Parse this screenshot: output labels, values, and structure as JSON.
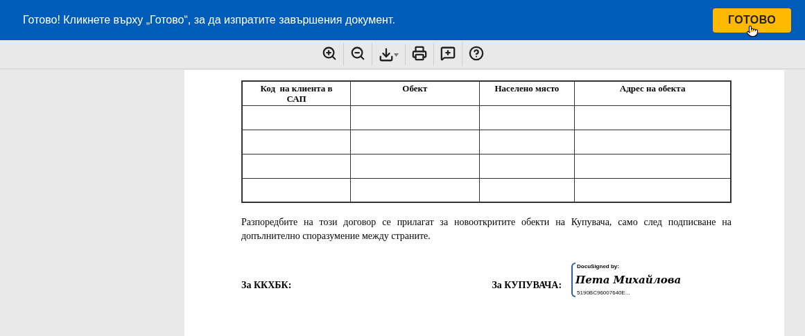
{
  "banner": {
    "message": "Готово! Кликнете върху „Готово“, за да изпратите завършения документ.",
    "button": "ГОТОВО"
  },
  "toolbar": {
    "tools": [
      {
        "kind": "zoom-in"
      },
      {
        "kind": "zoom-out"
      },
      {
        "kind": "download"
      },
      {
        "kind": "print"
      },
      {
        "kind": "comment"
      },
      {
        "kind": "help"
      }
    ]
  },
  "document": {
    "table": {
      "columns": [
        "Код  на клиента в САП",
        "Обект",
        "Населено място",
        "Адрес на обекта"
      ]
    },
    "paragraph": "Разпоредбите на този договор се прилагат за новооткритите обекти на Купувача, само след подписване на допълнително споразумение между страните.",
    "left_party": "За ККХБК:",
    "right_party": "За КУПУВАЧА:",
    "signature": {
      "header": "DocuSigned by:",
      "name": "Пета Михайлова",
      "id": "5190BC96007640E..."
    }
  }
}
